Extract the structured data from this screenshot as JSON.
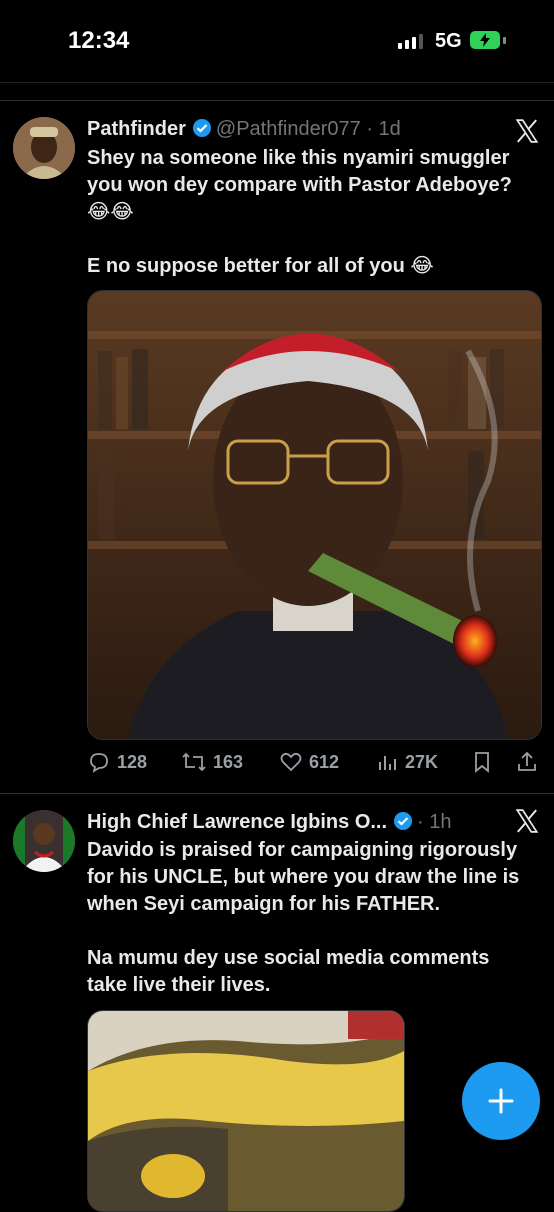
{
  "status_bar": {
    "time": "12:34",
    "network": "5G"
  },
  "tweets": [
    {
      "name": "Pathfinder",
      "handle": "@Pathfinder077",
      "time": "· 1d",
      "text_lines": [
        "Shey na someone like this nyamiri smuggler",
        "you won dey compare with Pastor Adeboye?"
      ],
      "emoji_line": "😂😂",
      "text_line_2": "E no suppose better for all of you 😂",
      "stats": {
        "replies": "128",
        "reposts": "163",
        "likes": "612",
        "views": "27K"
      }
    },
    {
      "name": "High Chief Lawrence Igbins O...",
      "time": "· 1h",
      "text_lines": [
        "Davido is praised for campaigning rigorously",
        "for his UNCLE, but where you draw the line is",
        "when Seyi campaign for his FATHER."
      ],
      "text_lines_2": [
        "Na mumu dey use social media comments",
        "take live their lives."
      ]
    }
  ],
  "colors": {
    "accent": "#1d9bf0",
    "background": "#000000",
    "muted": "#71767b"
  }
}
